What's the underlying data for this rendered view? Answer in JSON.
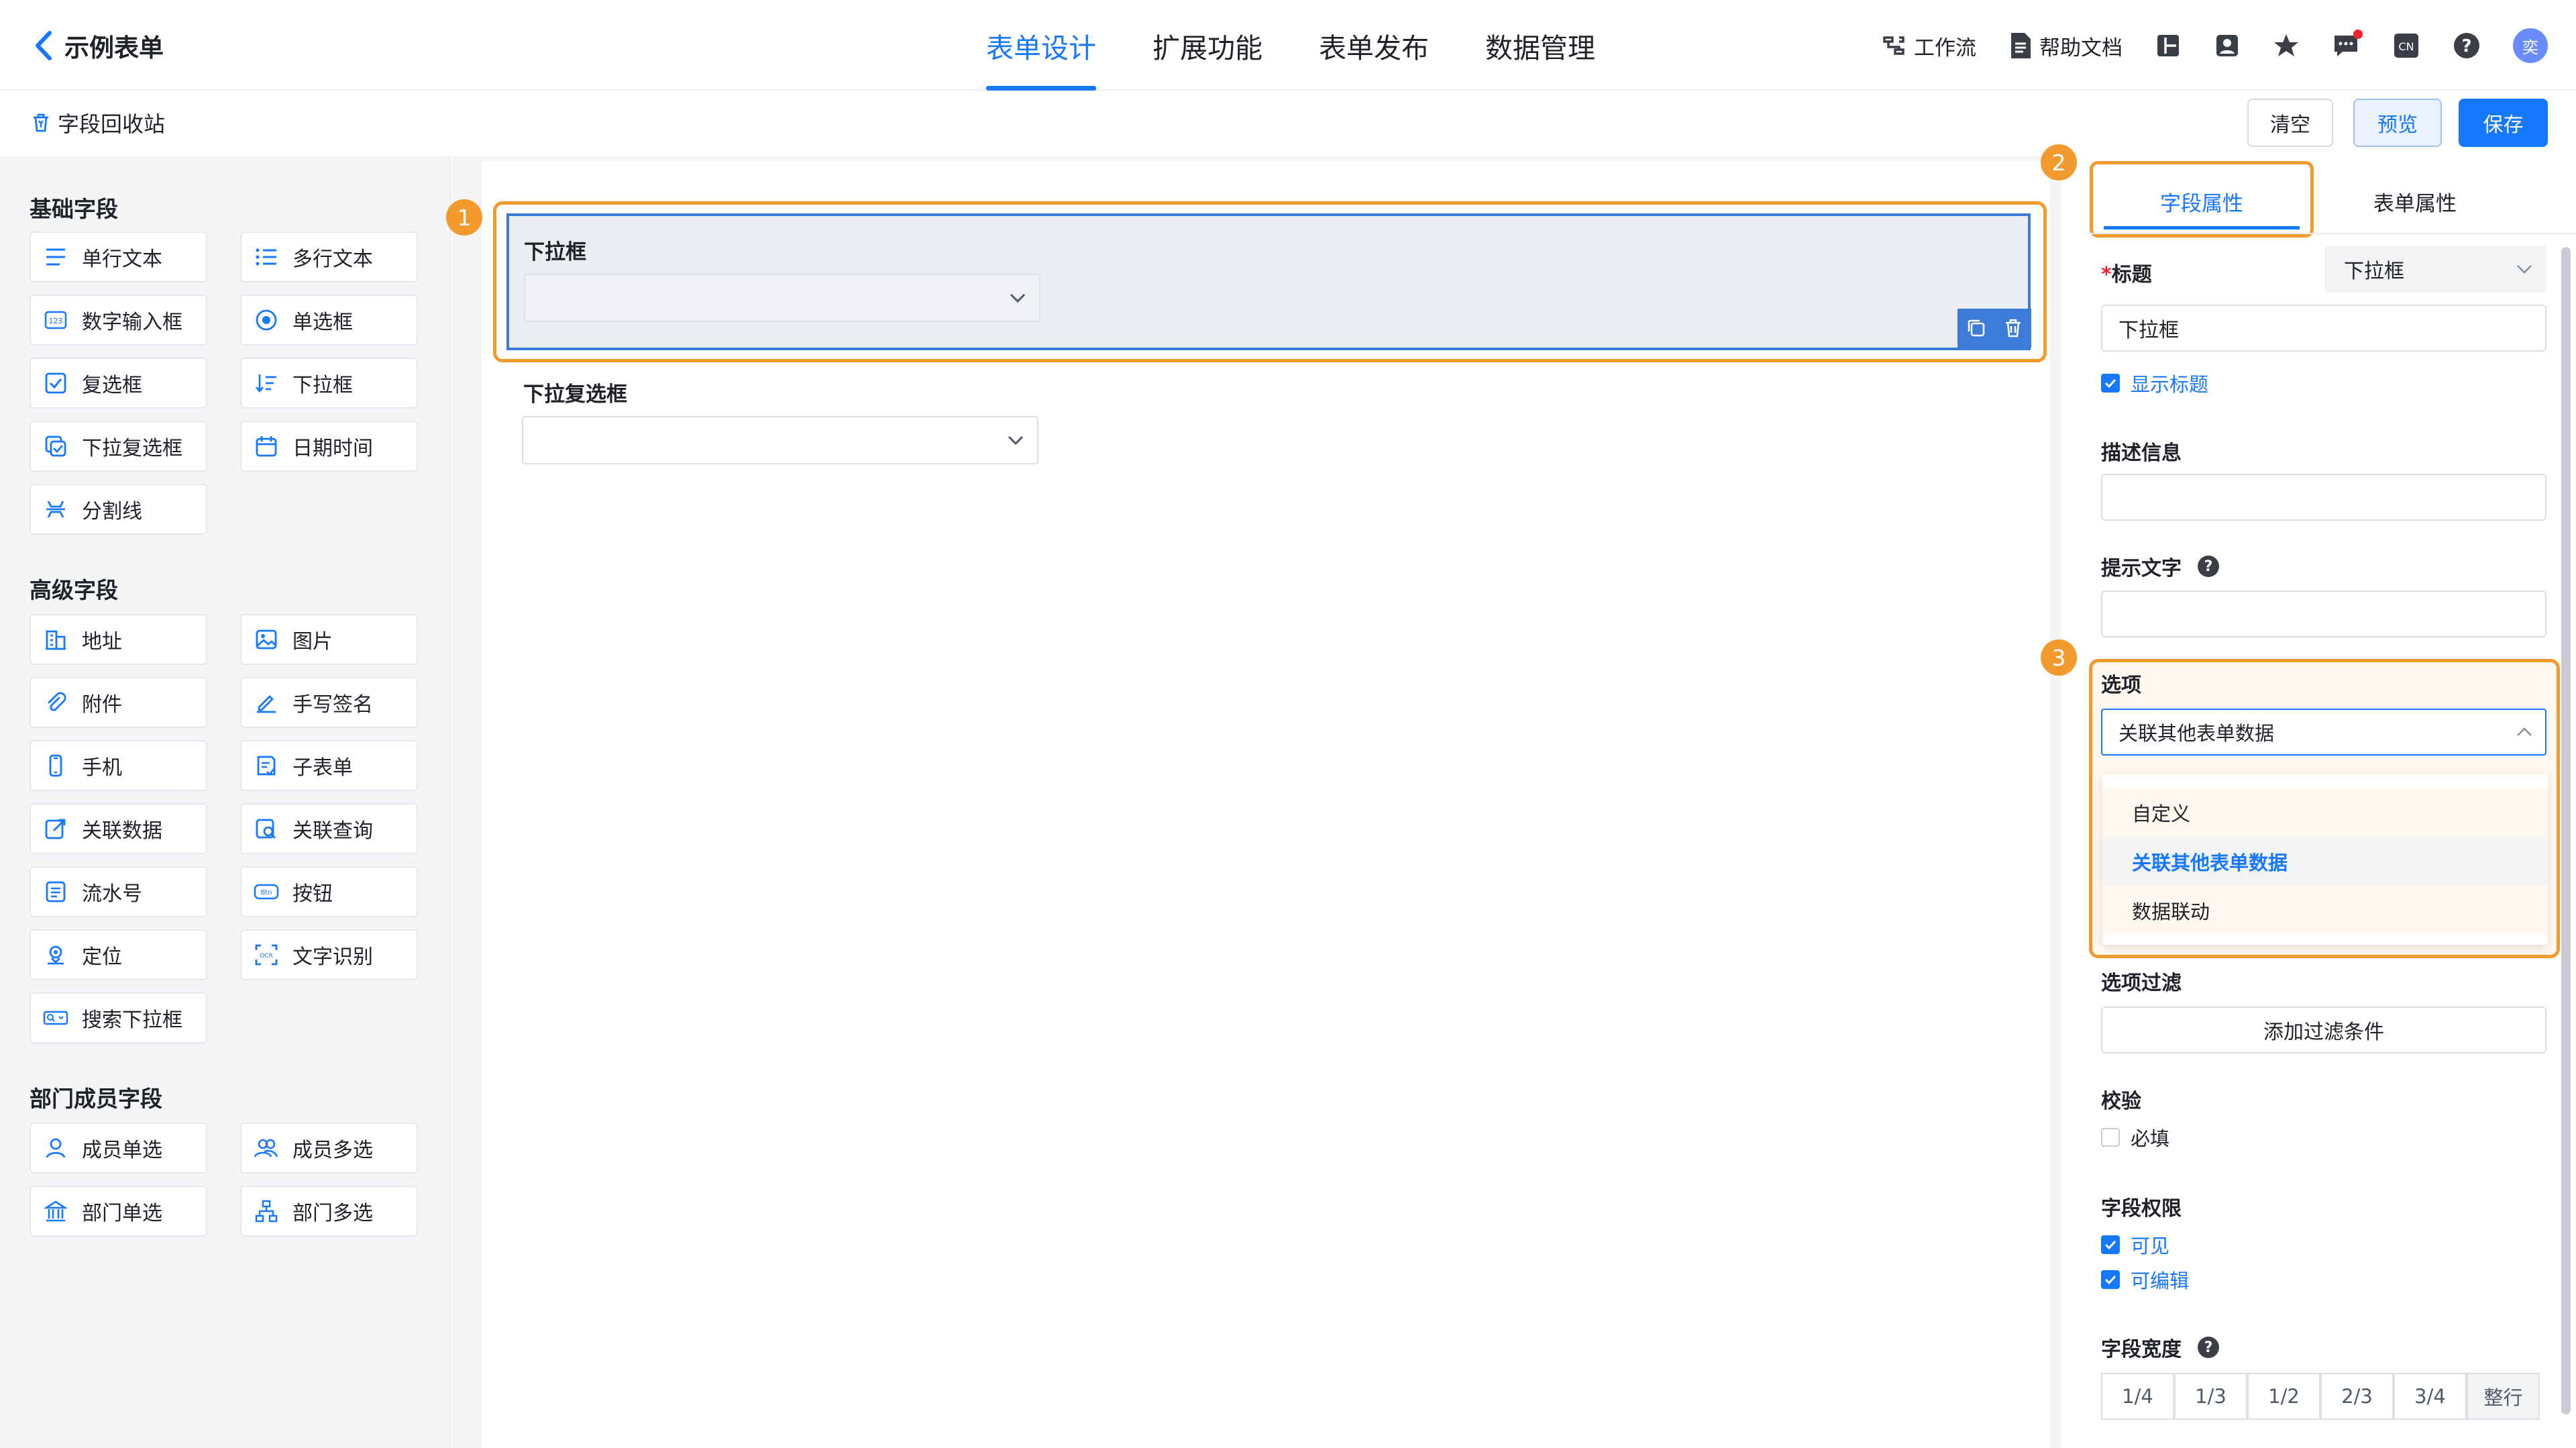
{
  "header": {
    "title": "示例表单",
    "tabs": [
      {
        "label": "表单设计",
        "active": true
      },
      {
        "label": "扩展功能",
        "active": false
      },
      {
        "label": "表单发布",
        "active": false
      },
      {
        "label": "数据管理",
        "active": false
      }
    ],
    "workflow_label": "工作流",
    "help_label": "帮助文档",
    "lang_icon_text": "CN",
    "avatar_text": "奕"
  },
  "toolbar": {
    "recycle_label": "字段回收站",
    "clear_label": "清空",
    "preview_label": "预览",
    "save_label": "保存"
  },
  "palette": {
    "basic_title": "基础字段",
    "basic": [
      {
        "label": "单行文本",
        "icon": "single-line-text-icon"
      },
      {
        "label": "多行文本",
        "icon": "multi-line-text-icon"
      },
      {
        "label": "数字输入框",
        "icon": "number-input-icon"
      },
      {
        "label": "单选框",
        "icon": "radio-icon"
      },
      {
        "label": "复选框",
        "icon": "checkbox-icon"
      },
      {
        "label": "下拉框",
        "icon": "dropdown-icon"
      },
      {
        "label": "下拉复选框",
        "icon": "dropdown-checkbox-icon"
      },
      {
        "label": "日期时间",
        "icon": "calendar-icon"
      },
      {
        "label": "分割线",
        "icon": "divider-icon"
      }
    ],
    "advanced_title": "高级字段",
    "advanced": [
      {
        "label": "地址",
        "icon": "address-icon"
      },
      {
        "label": "图片",
        "icon": "image-icon"
      },
      {
        "label": "附件",
        "icon": "attachment-icon"
      },
      {
        "label": "手写签名",
        "icon": "signature-icon"
      },
      {
        "label": "手机",
        "icon": "phone-icon"
      },
      {
        "label": "子表单",
        "icon": "subform-icon"
      },
      {
        "label": "关联数据",
        "icon": "linked-data-icon"
      },
      {
        "label": "关联查询",
        "icon": "linked-query-icon"
      },
      {
        "label": "流水号",
        "icon": "serial-number-icon"
      },
      {
        "label": "按钮",
        "icon": "button-icon",
        "icon_text": "Btn"
      },
      {
        "label": "定位",
        "icon": "location-icon"
      },
      {
        "label": "文字识别",
        "icon": "ocr-icon",
        "icon_text": "OCR"
      },
      {
        "label": "搜索下拉框",
        "icon": "search-dropdown-icon"
      }
    ],
    "member_title": "部门成员字段",
    "member": [
      {
        "label": "成员单选",
        "icon": "member-single-icon"
      },
      {
        "label": "成员多选",
        "icon": "member-multi-icon"
      },
      {
        "label": "部门单选",
        "icon": "department-single-icon"
      },
      {
        "label": "部门多选",
        "icon": "department-multi-icon"
      }
    ]
  },
  "canvas": {
    "fields": [
      {
        "label": "下拉框",
        "selected": true
      },
      {
        "label": "下拉复选框",
        "selected": false
      }
    ],
    "badges": [
      "1",
      "2",
      "3"
    ]
  },
  "props": {
    "tabs": [
      "字段属性",
      "表单属性"
    ],
    "title_label": "标题",
    "title_required_mark": "*",
    "title_type_select": "下拉框",
    "title_value": "下拉框",
    "show_title_label": "显示标题",
    "show_title_checked": true,
    "desc_label": "描述信息",
    "desc_value": "",
    "hint_label": "提示文字",
    "hint_value": "",
    "options_label": "选项",
    "options_selected": "关联其他表单数据",
    "options_menu": [
      "自定义",
      "关联其他表单数据",
      "数据联动"
    ],
    "filter_label": "选项过滤",
    "filter_button": "添加过滤条件",
    "validation_label": "校验",
    "required_label": "必填",
    "required_checked": false,
    "permission_label": "字段权限",
    "visible_label": "可见",
    "visible_checked": true,
    "editable_label": "可编辑",
    "editable_checked": true,
    "width_label": "字段宽度",
    "widths": [
      "1/4",
      "1/3",
      "1/2",
      "2/3",
      "3/4",
      "整行"
    ],
    "width_active": "整行"
  },
  "colors": {
    "accent": "#1677ff",
    "highlight": "#f39a2e",
    "selected_field_border": "#3d7bd9"
  }
}
